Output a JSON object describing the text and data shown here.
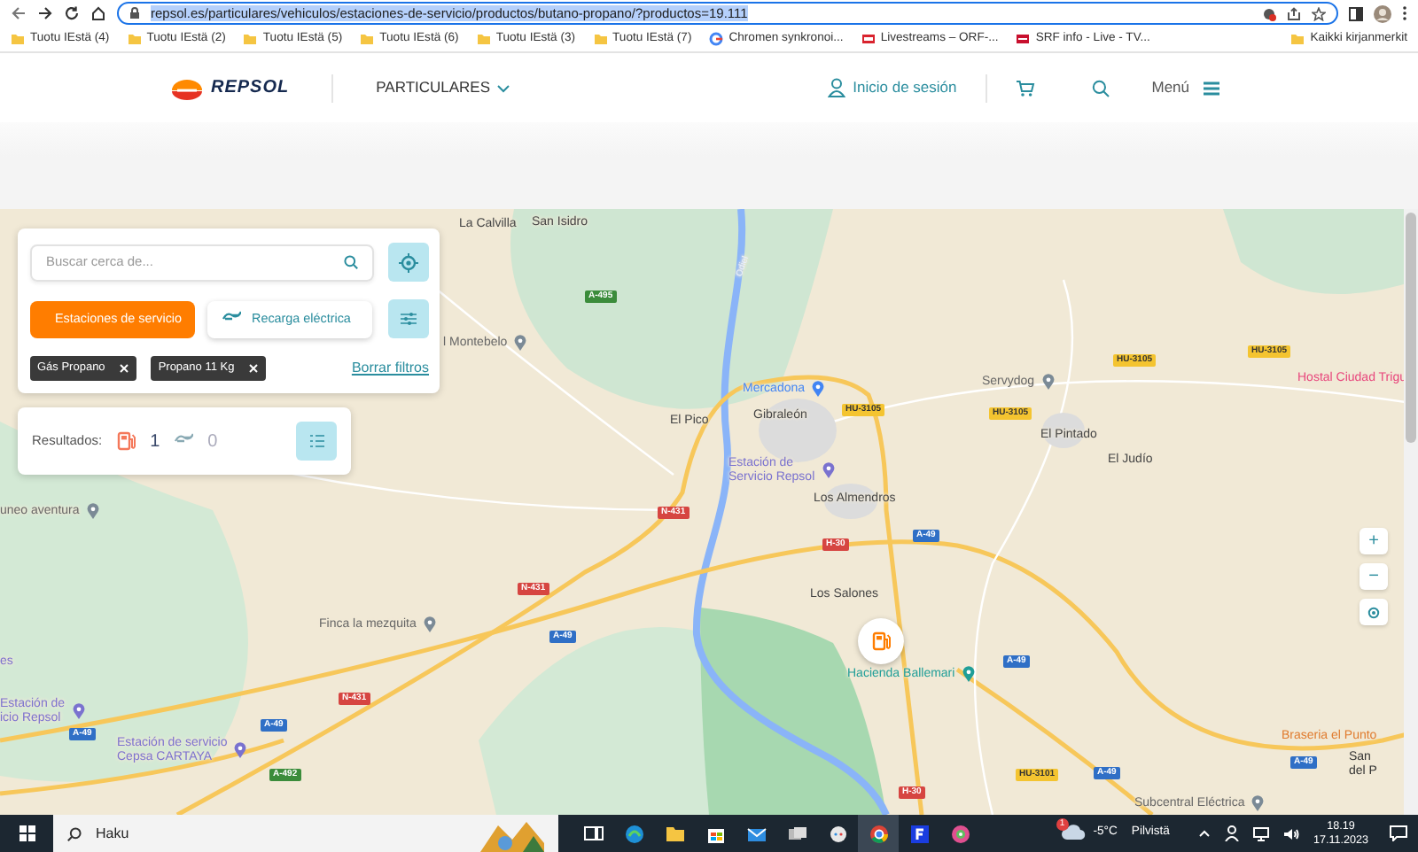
{
  "browser": {
    "url": "repsol.es/particulares/vehiculos/estaciones-de-servicio/productos/butano-propano/?productos=19.111",
    "url_highlighted": true
  },
  "bookmarks": [
    {
      "label": "Tuotu IEstä (4)",
      "kind": "folder"
    },
    {
      "label": "Tuotu IEstä (2)",
      "kind": "folder"
    },
    {
      "label": "Tuotu IEstä (5)",
      "kind": "folder"
    },
    {
      "label": "Tuotu IEstä (6)",
      "kind": "folder"
    },
    {
      "label": "Tuotu IEstä (3)",
      "kind": "folder"
    },
    {
      "label": "Tuotu IEstä (7)",
      "kind": "folder"
    },
    {
      "label": "Chromen synkronoi...",
      "kind": "google"
    },
    {
      "label": "Livestreams – ORF-...",
      "kind": "orf"
    },
    {
      "label": "SRF info - Live - TV...",
      "kind": "srf"
    }
  ],
  "all_bookmarks": "Kaikki kirjanmerkit",
  "site_header": {
    "logo": "REPSOL",
    "section": "PARTICULARES",
    "login": "Inicio de sesión",
    "menu": "Menú"
  },
  "search_panel": {
    "placeholder": "Buscar cerca de...",
    "types": [
      {
        "label": "Estaciones de servicio",
        "kind": "fuel",
        "selected": true
      },
      {
        "label": "Recarga eléctrica",
        "kind": "charge",
        "selected": false
      }
    ],
    "filters": [
      {
        "label": "Gás Propano"
      },
      {
        "label": "Propano 11 Kg"
      }
    ],
    "clear": "Borrar filtros"
  },
  "results": {
    "label": "Resultados:",
    "counts": [
      {
        "kind": "fuel",
        "count": "1",
        "active": true
      },
      {
        "kind": "charge",
        "count": "0",
        "active": false
      }
    ]
  },
  "map": {
    "labels": [
      {
        "text": "La Calvilla",
        "kind": "place",
        "color": "#444444"
      },
      {
        "text": "San Isidro",
        "kind": "place",
        "color": "#444444"
      },
      {
        "text": "Odiel",
        "kind": "water",
        "color": "#e9f1ff"
      },
      {
        "text": "A-495",
        "kind": "road",
        "color": "#3b8c3b"
      },
      {
        "text": "l Montebelo",
        "kind": "poi",
        "color": "#666666"
      },
      {
        "text": "Mercadona",
        "kind": "poi",
        "color": "#4285f4"
      },
      {
        "text": "El Pico",
        "kind": "place",
        "color": "#444444"
      },
      {
        "text": "Gibraleón",
        "kind": "place",
        "color": "#444444"
      },
      {
        "text": "HU-3105",
        "kind": "road",
        "color": "#f4c430"
      },
      {
        "text": "Servydog",
        "kind": "poi",
        "color": "#666666"
      },
      {
        "text": "HU-3105",
        "kind": "road",
        "color": "#f4c430"
      },
      {
        "text": "HU-3105",
        "kind": "road",
        "color": "#f4c430"
      },
      {
        "text": "HU-3105",
        "kind": "road",
        "color": "#f4c430"
      },
      {
        "text": "Hostal Ciudad Trigu",
        "kind": "place",
        "color": "#e8457c"
      },
      {
        "text": "El Pintado",
        "kind": "place",
        "color": "#444444"
      },
      {
        "text": "El Judío",
        "kind": "place",
        "color": "#444444"
      },
      {
        "text": "Estación de\nServicio Repsol",
        "kind": "poi",
        "color": "#7a72cf"
      },
      {
        "text": "Los Almendros",
        "kind": "place",
        "color": "#444444"
      },
      {
        "text": "N-431",
        "kind": "road",
        "color": "#d64541"
      },
      {
        "text": "A-49",
        "kind": "road",
        "color": "#2f6fc6"
      },
      {
        "text": "H-30",
        "kind": "road",
        "color": "#d64541"
      },
      {
        "text": "uneo aventura",
        "kind": "poi",
        "color": "#666666"
      },
      {
        "text": "N-431",
        "kind": "road",
        "color": "#d64541"
      },
      {
        "text": "Los Salones",
        "kind": "place",
        "color": "#444444"
      },
      {
        "text": "Finca la mezquita",
        "kind": "poi",
        "color": "#666666"
      },
      {
        "text": "A-49",
        "kind": "road",
        "color": "#2f6fc6"
      },
      {
        "text": "es",
        "kind": "place",
        "color": "#7a72cf"
      },
      {
        "text": "A-49",
        "kind": "road",
        "color": "#2f6fc6"
      },
      {
        "text": "Hacienda Ballemari",
        "kind": "poi",
        "color": "#1f9e98"
      },
      {
        "text": "Estación de\nicio Repsol",
        "kind": "poi",
        "color": "#7a72cf"
      },
      {
        "text": "N-431",
        "kind": "road",
        "color": "#d64541"
      },
      {
        "text": "A-49",
        "kind": "road",
        "color": "#2f6fc6"
      },
      {
        "text": "A-49",
        "kind": "road",
        "color": "#2f6fc6"
      },
      {
        "text": "Estación de servicio\nCepsa CARTAYA",
        "kind": "poi",
        "color": "#7a72cf"
      },
      {
        "text": "Braseria el Punto",
        "kind": "place",
        "color": "#e07b2e"
      },
      {
        "text": "A-492",
        "kind": "road",
        "color": "#3b8c3b"
      },
      {
        "text": "HU-3101",
        "kind": "road",
        "color": "#f4c430"
      },
      {
        "text": "A-49",
        "kind": "road",
        "color": "#2f6fc6"
      },
      {
        "text": "A-49",
        "kind": "road",
        "color": "#2f6fc6"
      },
      {
        "text": "San\ndel P",
        "kind": "place",
        "color": "#333333"
      },
      {
        "text": "H-30",
        "kind": "road",
        "color": "#d64541"
      },
      {
        "text": "Subcentral Eléctrica",
        "kind": "poi",
        "color": "#666666"
      }
    ],
    "zoom_in": "+",
    "zoom_out": "−"
  },
  "taskbar": {
    "search": "Haku",
    "apps": [
      {
        "kind": "taskview",
        "selected": false
      },
      {
        "kind": "edge",
        "selected": false
      },
      {
        "kind": "explorer",
        "selected": false
      },
      {
        "kind": "store",
        "selected": false
      },
      {
        "kind": "mail",
        "selected": false
      },
      {
        "kind": "cards",
        "selected": false
      },
      {
        "kind": "bubble",
        "selected": false
      },
      {
        "kind": "chrome",
        "selected": true
      },
      {
        "kind": "fapp",
        "selected": false
      },
      {
        "kind": "photos",
        "selected": false
      }
    ],
    "weather_badge": "1",
    "temperature": "-5°C",
    "weather": "Pilvistä",
    "time": "18.19",
    "date": "17.11.2023"
  }
}
